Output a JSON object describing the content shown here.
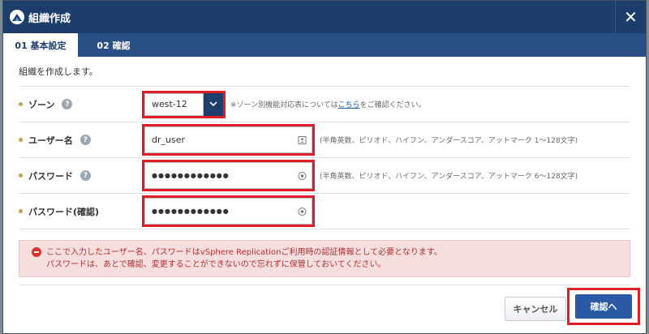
{
  "dialog": {
    "title": "組織作成",
    "close_icon": "close-icon"
  },
  "tabs": [
    {
      "label": "01 基本設定"
    },
    {
      "label": "02 確認"
    }
  ],
  "intro": "組織を作成します。",
  "form": {
    "zone": {
      "label": "ゾーン",
      "value": "west-12",
      "hint_prefix": "※ゾーン別機能対応表については",
      "hint_link": "こちら",
      "hint_suffix": "をご確認ください。"
    },
    "username": {
      "label": "ユーザー名",
      "value": "dr_user",
      "hint": "(半角英数、ピリオド、ハイフン、アンダースコア、アットマーク 1〜128文字)"
    },
    "password": {
      "label": "パスワード",
      "value": "●●●●●●●●●●●●",
      "hint": "(半角英数、ピリオド、ハイフン、アンダースコア、アットマーク 6〜128文字)"
    },
    "password_confirm": {
      "label": "パスワード(確認)",
      "value": "●●●●●●●●●●●●"
    }
  },
  "error": {
    "line1": "ここで入力したユーザー名、パスワードはvSphere Replicationご利用時の認証情報として必要となります。",
    "line2": "パスワードは、あとで確認、変更することができないので忘れずに保管しておいてください。"
  },
  "buttons": {
    "cancel": "キャンセル",
    "confirm": "確認へ"
  },
  "colors": {
    "header": "#1d3d6b",
    "tabs": "#2a4f86",
    "highlight": "#e01d25",
    "primary_button": "#2a5aa3"
  }
}
